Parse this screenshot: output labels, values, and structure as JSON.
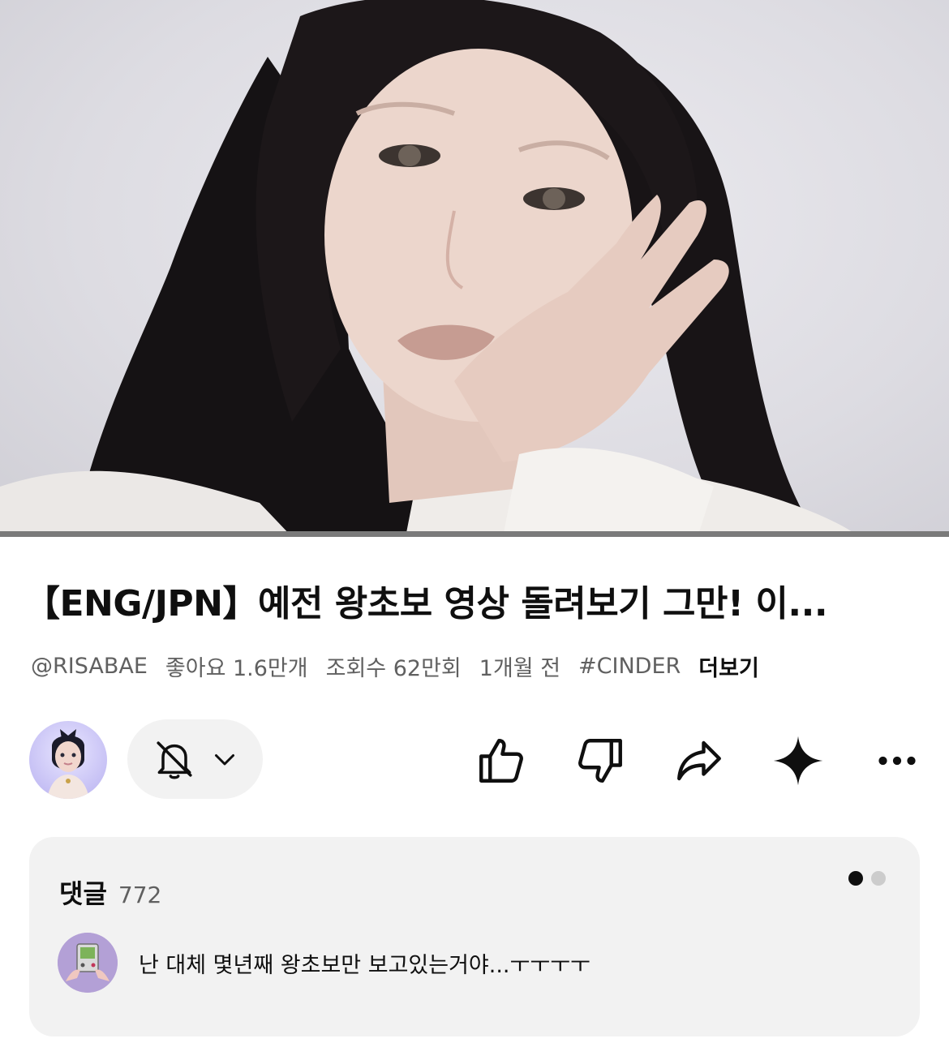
{
  "video": {
    "progress_fraction": 0.0,
    "progress_color": "#ff0000"
  },
  "title": "【ENG/JPN】예전 왕초보 영상 돌려보기 그만! 이...",
  "meta": {
    "channel": "@RISABAE",
    "likes": "좋아요 1.6만개",
    "views": "조회수 62만회",
    "date": "1개월 전",
    "tag": "#CINDER",
    "more": "더보기"
  },
  "actions": {
    "avatar_icon": "channel-avatar",
    "subscribe_icon": "bell-off-icon",
    "dropdown_icon": "chevron-down-icon",
    "like_icon": "thumb-up-icon",
    "dislike_icon": "thumb-down-icon",
    "share_icon": "share-icon",
    "ask_icon": "sparkle-icon",
    "more_icon": "more-horizontal-icon"
  },
  "comments": {
    "label": "댓글",
    "count": "772",
    "pager_active_color": "#0f0f0f",
    "pager_inactive_color": "#cccccc",
    "top_comment": {
      "text": "난 대체 몇년째 왕초보만 보고있는거야...ㅜㅜㅜㅜ"
    }
  }
}
